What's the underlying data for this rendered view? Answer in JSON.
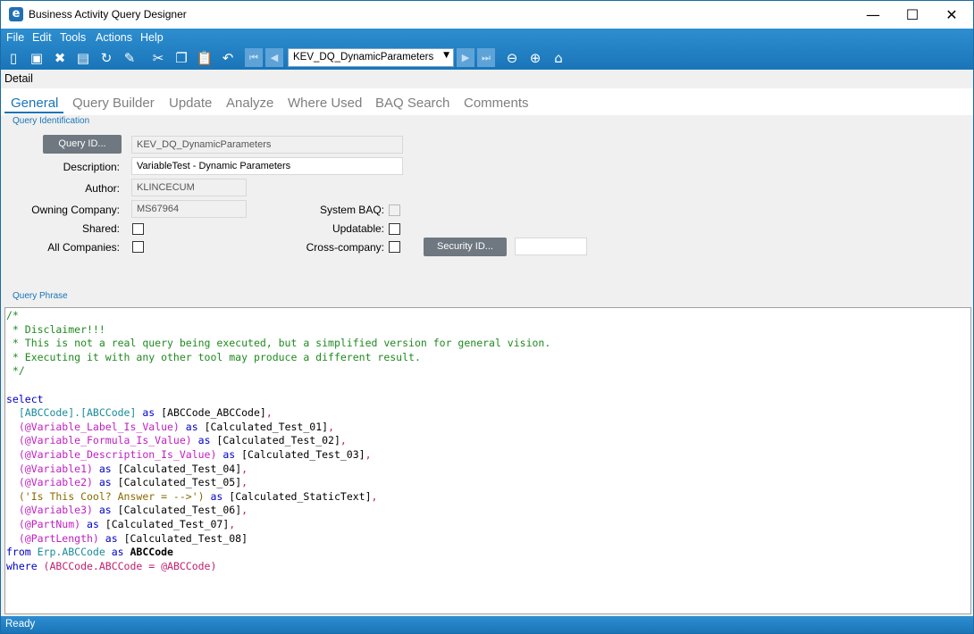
{
  "window": {
    "title": "Business Activity Query Designer",
    "minimize_glyph": "—",
    "maximize_glyph": "☐",
    "close_glyph": "✕"
  },
  "menu": [
    "File",
    "Edit",
    "Tools",
    "Actions",
    "Help"
  ],
  "toolbar": {
    "query_combo_value": "KEV_DQ_DynamicParameters"
  },
  "detail": {
    "label": "Detail"
  },
  "tabs": [
    "General",
    "Query Builder",
    "Update",
    "Analyze",
    "Where Used",
    "BAQ Search",
    "Comments"
  ],
  "query_identification": {
    "group_label": "Query Identification",
    "query_id_button": "Query ID...",
    "query_id_value": "KEV_DQ_DynamicParameters",
    "description_label": "Description:",
    "description_value": "VariableTest - Dynamic Parameters",
    "author_label": "Author:",
    "author_value": "KLINCECUM",
    "owning_company_label": "Owning Company:",
    "owning_company_value": "MS67964",
    "shared_label": "Shared:",
    "all_companies_label": "All Companies:",
    "system_baq_label": "System BAQ:",
    "updatable_label": "Updatable:",
    "cross_company_label": "Cross-company:",
    "security_id_button": "Security ID...",
    "security_id_value": ""
  },
  "query_phrase": {
    "group_label": "Query Phrase",
    "lines": {
      "l1": "/*",
      "l2": " * Disclaimer!!!",
      "l3": " * This is not a real query being executed, but a simplified version for general vision.",
      "l4": " * Executing it with any other tool may produce a different result.",
      "l5": " */",
      "l7": "select",
      "l8a": "  [ABCCode].[ABCCode]",
      "l8b": " as ",
      "l8c": "[ABCCode_ABCCode]",
      "l8d": ",",
      "l9a": "  (@Variable_Label_Is_Value)",
      "l9b": " as ",
      "l9c": "[Calculated_Test_01]",
      "l9d": ",",
      "l10a": "  (@Variable_Formula_Is_Value)",
      "l10b": " as ",
      "l10c": "[Calculated_Test_02]",
      "l10d": ",",
      "l11a": "  (@Variable_Description_Is_Value)",
      "l11b": " as ",
      "l11c": "[Calculated_Test_03]",
      "l11d": ",",
      "l12a": "  (@Variable1)",
      "l12b": " as ",
      "l12c": "[Calculated_Test_04]",
      "l12d": ",",
      "l13a": "  (@Variable2)",
      "l13b": " as ",
      "l13c": "[Calculated_Test_05]",
      "l13d": ",",
      "l14a": "  ('Is This Cool? Answer = -->')",
      "l14b": " as ",
      "l14c": "[Calculated_StaticText]",
      "l14d": ",",
      "l15a": "  (@Variable3)",
      "l15b": " as ",
      "l15c": "[Calculated_Test_06]",
      "l15d": ",",
      "l16a": "  (@PartNum)",
      "l16b": " as ",
      "l16c": "[Calculated_Test_07]",
      "l16d": ",",
      "l17a": "  (@PartLength)",
      "l17b": " as ",
      "l17c": "[Calculated_Test_08]",
      "l18a": "from ",
      "l18b": "Erp.ABCCode",
      "l18c": " as ",
      "l18d": "ABCCode",
      "l19a": "where ",
      "l19b": "(ABCCode.ABCCode = @ABCCode)"
    }
  },
  "status": {
    "text": "Ready"
  }
}
